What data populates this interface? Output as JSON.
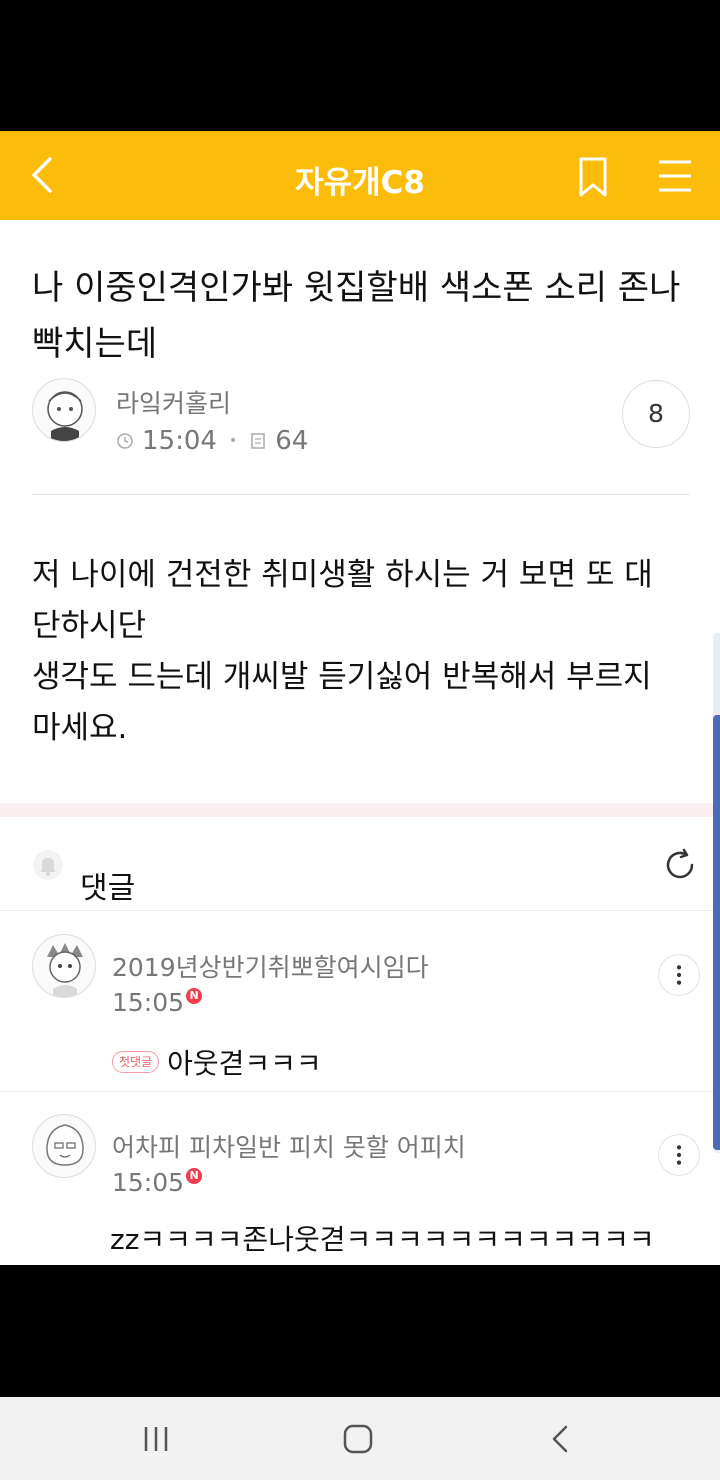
{
  "header": {
    "title": "자유개C8"
  },
  "post": {
    "title": "나 이중인격인가봐 윗집할배 색소폰 소리 존나 빡치는데",
    "author": "라잌커홀리",
    "time": "15:04",
    "views": "64",
    "comment_count": "8",
    "body_lines": [
      "저 나이에 건전한 취미생활 하시는 거 보면 또 대",
      "단하시단",
      "생각도 드는데 개씨발 듣기싫어 반복해서 부르지",
      "마세요."
    ]
  },
  "comments_section": {
    "label": "댓글"
  },
  "comments": [
    {
      "author": "2019년상반기취뽀할여시임다",
      "time": "15:05",
      "new_badge": "N",
      "first_badge": "첫댓글",
      "text": "아웃겯ㅋㅋㅋ"
    },
    {
      "author": "어차피 피차일반 피치 못할 어피치",
      "time": "15:05",
      "new_badge": "N",
      "text": "zzㅋㅋㅋㅋ존나웃겯ㅋㅋㅋㅋㅋㅋㅋㅋㅋㅋㅋㅋ"
    }
  ],
  "colors": {
    "header_bg": "#fbbd0a",
    "new_badge": "#f23c4b",
    "scroll_thumb": "#4a6db8",
    "section_band": "#fbeef0"
  },
  "icons": [
    "back-arrow-icon",
    "bookmark-icon",
    "hamburger-menu-icon",
    "clock-icon",
    "views-icon",
    "bell-icon",
    "refresh-icon",
    "more-vertical-icon",
    "recent-apps-icon",
    "home-icon",
    "nav-back-icon"
  ]
}
